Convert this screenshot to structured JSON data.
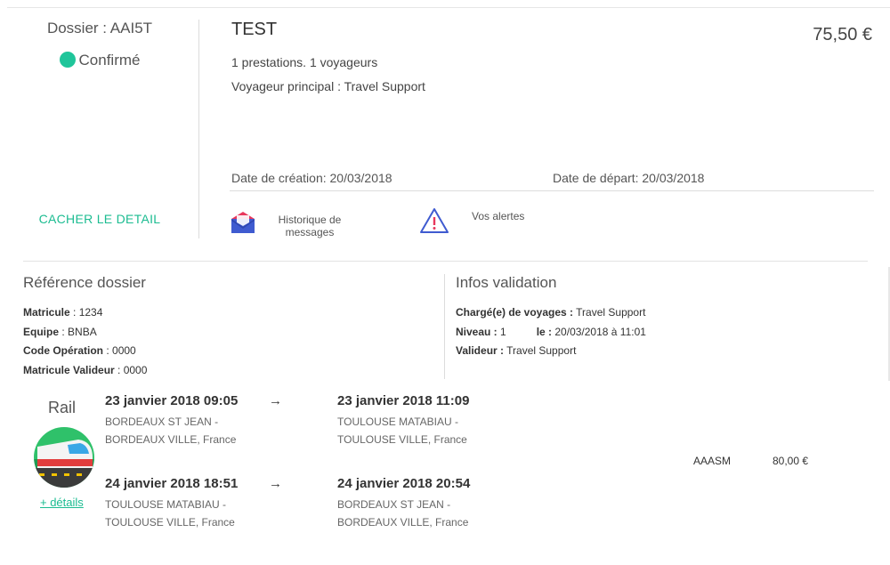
{
  "dossier": {
    "number": "Dossier : AAI5T",
    "status": "Confirmé",
    "status_color": "#1fc59a",
    "hide_detail_label": "CACHER LE DETAIL"
  },
  "summary": {
    "title": "TEST",
    "price": "75,50 €",
    "services_line": "1 prestations. 1 voyageurs",
    "main_traveler": "Voyageur principal : Travel Support",
    "creation_date": "Date de création: 20/03/2018",
    "departure_date": "Date de départ: 20/03/2018"
  },
  "actions": {
    "messages_line1": "Historique de",
    "messages_line2": "messages",
    "messages_icon": "envelope-icon",
    "alerts_label": "Vos alertes",
    "alerts_icon": "warning-triangle-icon"
  },
  "reference": {
    "title": "Référence dossier",
    "rows": [
      {
        "key": "Matricule",
        "value": " : 1234"
      },
      {
        "key": "Equipe",
        "value": " : BNBA"
      },
      {
        "key": "Code Opération",
        "value": " : 0000"
      },
      {
        "key": "Matricule Valideur",
        "value": " : 0000"
      }
    ]
  },
  "validation": {
    "title": "Infos validation",
    "charge_key": "Chargé(e) de voyages :",
    "charge_value": " Travel Support",
    "level_key": "Niveau :",
    "level_value": " 1",
    "date_key": "le :",
    "date_value": " 20/03/2018 à 11:01",
    "validator_key": "Valideur :",
    "validator_value": " Travel Support"
  },
  "rail": {
    "label": "Rail",
    "icon": "train-icon",
    "details_link": "+ détails",
    "code": "AAASM",
    "amount": "80,00 €",
    "segments": [
      {
        "dep_datetime": "23 janvier 2018 09:05",
        "dep_station": "BORDEAUX ST JEAN -",
        "dep_city": "BORDEAUX VILLE, France",
        "arrow": "→",
        "arr_datetime": "23 janvier 2018 11:09",
        "arr_station": "TOULOUSE MATABIAU -",
        "arr_city": "TOULOUSE VILLE, France"
      },
      {
        "dep_datetime": "24 janvier 2018 18:51",
        "dep_station": "TOULOUSE MATABIAU -",
        "dep_city": "TOULOUSE VILLE, France",
        "arrow": "→",
        "arr_datetime": "24 janvier 2018 20:54",
        "arr_station": "BORDEAUX ST JEAN -",
        "arr_city": "BORDEAUX VILLE, France"
      }
    ]
  }
}
